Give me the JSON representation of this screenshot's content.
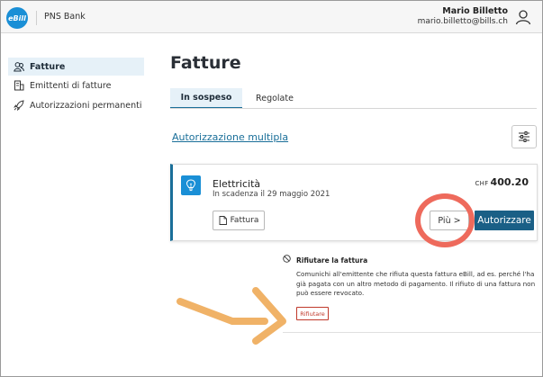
{
  "header": {
    "logo_text": "eBill",
    "bank_name": "PNS Bank",
    "user_name": "Mario Billetto",
    "user_email": "mario.billetto@bills.ch"
  },
  "sidebar": {
    "items": [
      {
        "label": "Fatture",
        "icon": "invoices-icon",
        "active": true
      },
      {
        "label": "Emittenti di fatture",
        "icon": "building-icon",
        "active": false
      },
      {
        "label": "Autorizzazioni permanenti",
        "icon": "rocket-icon",
        "active": false
      }
    ]
  },
  "main": {
    "title": "Fatture",
    "tabs": [
      {
        "label": "In sospeso",
        "active": true
      },
      {
        "label": "Regolate",
        "active": false
      }
    ],
    "multi_auth_link": "Autorizzazione multipla",
    "filter_icon": "sliders-icon"
  },
  "invoice": {
    "title": "Elettricità",
    "due": "In scadenza il 29 maggio 2021",
    "currency": "CHF",
    "amount": "400.20",
    "invoice_button": "Fattura",
    "more_button": "Più >",
    "authorize_button": "Autorizzare",
    "icon": "lightbulb-icon"
  },
  "reject": {
    "title": "Rifiutare la fattura",
    "text": "Comunichi all'emittente che rifiuta questa fattura eBill, ad es. perché l'ha già pagata con un altro metodo di pagamento. Il rifiuto di una fattura non può essere revocato.",
    "button": "Rifiutare"
  },
  "colors": {
    "accent": "#1a6f99",
    "brand": "#1a8fd6",
    "primary_button": "#1a5f86",
    "highlight": "#ee6a5c",
    "annotation_arrow": "#f0b267",
    "reject": "#c0392b"
  }
}
